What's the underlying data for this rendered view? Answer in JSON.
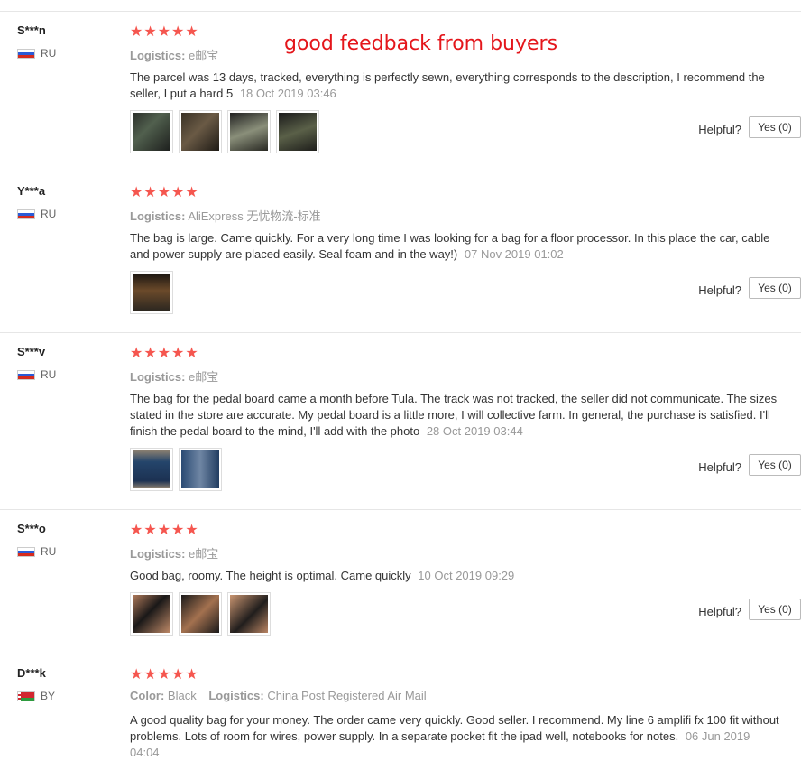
{
  "overlay_text": "good feedback from buyers",
  "helpful_label": "Helpful?",
  "yes_label": "Yes (0)",
  "colors": {
    "star": "#f5564f",
    "overlay": "#e4161b"
  },
  "reviews": [
    {
      "user": "S***n",
      "country": "RU",
      "stars": "★★★★★",
      "logistics_label": "Logistics:",
      "logistics": "e邮宝",
      "text": "The parcel was 13 days, tracked, everything is perfectly sewn, everything corresponds to the description, I recommend the seller, I put a hard 5",
      "date": "18 Oct 2019 03:46",
      "photos": 4
    },
    {
      "user": "Y***a",
      "country": "RU",
      "stars": "★★★★★",
      "logistics_label": "Logistics:",
      "logistics": "AliExpress 无忧物流-标准",
      "text": "The bag is large. Came quickly. For a very long time I was looking for a bag for a floor processor. In this place the car, cable and power supply are placed easily. Seal foam and in the way!)",
      "date": "07 Nov 2019 01:02",
      "photos": 1
    },
    {
      "user": "S***v",
      "country": "RU",
      "stars": "★★★★★",
      "logistics_label": "Logistics:",
      "logistics": "e邮宝",
      "text": "The bag for the pedal board came a month before Tula. The track was not tracked, the seller did not communicate. The sizes stated in the store are accurate. My pedal board is a little more, I will collective farm. In general, the purchase is satisfied. I'll finish the pedal board to the mind, I'll add with the photo",
      "date": "28 Oct 2019 03:44",
      "photos": 2
    },
    {
      "user": "S***o",
      "country": "RU",
      "stars": "★★★★★",
      "logistics_label": "Logistics:",
      "logistics": "e邮宝",
      "text": "Good bag, roomy. The height is optimal. Came quickly",
      "date": "10 Oct 2019 09:29",
      "photos": 3
    },
    {
      "user": "D***k",
      "country": "BY",
      "stars": "★★★★★",
      "color_label": "Color:",
      "color": "Black",
      "logistics_label": "Logistics:",
      "logistics": "China Post Registered Air Mail",
      "text": "A good quality bag for your money. The order came very quickly. Good seller. I recommend. My line 6 amplifi fx 100 fit without problems. Lots of room for wires, power supply. In a separate pocket fit the ipad well, notebooks for notes.",
      "date": "06 Jun 2019 04:04",
      "photos": 0
    }
  ]
}
